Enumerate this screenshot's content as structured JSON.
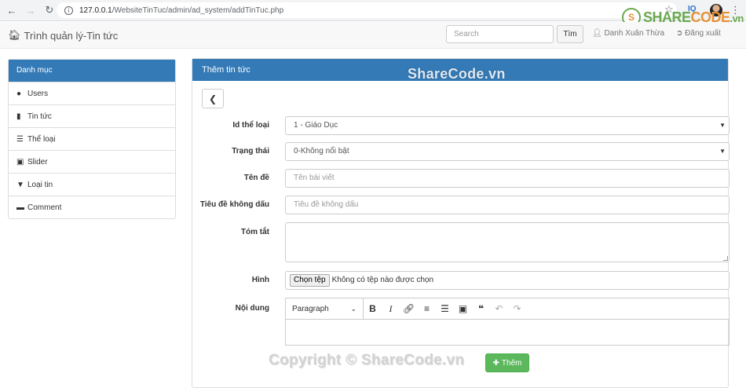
{
  "browser": {
    "url_host": "127.0.0.1",
    "url_path": "/WebsiteTinTuc/admin/ad_system/addTinTuc.php",
    "extension_label": "IQ"
  },
  "watermark": {
    "logo_share": "SHARE",
    "logo_code": "CODE",
    "logo_tld": ".vn",
    "logo_mark": "S",
    "top": "ShareCode.vn",
    "bottom": "Copyright © ShareCode.vn"
  },
  "navbar": {
    "brand": "Trình quản lý-Tin tức",
    "search_placeholder": "Search",
    "search_button": "Tìm",
    "user_name": "Danh Xuân Thừa",
    "logout": "Đăng xuất"
  },
  "sidebar": {
    "title": "Danh mục",
    "items": [
      {
        "label": "Users",
        "icon": "user-icon"
      },
      {
        "label": "Tin tức",
        "icon": "file-icon"
      },
      {
        "label": "Thể loại",
        "icon": "list-icon"
      },
      {
        "label": "Slider",
        "icon": "slider-icon"
      },
      {
        "label": "Loại tin",
        "icon": "filter-icon"
      },
      {
        "label": "Comment",
        "icon": "comment-icon"
      }
    ]
  },
  "form": {
    "title": "Thêm tin tức",
    "fields": {
      "category": {
        "label": "Id thể loại",
        "value": "1 - Giáo Dục"
      },
      "status": {
        "label": "Trạng thái",
        "value": "0-Không nổi bật"
      },
      "title": {
        "label": "Tên đề",
        "placeholder": "Tên bài viết"
      },
      "slug": {
        "label": "Tiêu đề không dấu",
        "placeholder": "Tiêu đề không dấu"
      },
      "summary": {
        "label": "Tóm tắt",
        "value": ""
      },
      "image": {
        "label": "Hình",
        "button": "Chọn tệp",
        "status": "Không có tệp nào được chọn"
      },
      "content": {
        "label": "Nội dung",
        "format": "Paragraph"
      }
    },
    "submit": "Thêm"
  },
  "colors": {
    "primary": "#337ab7",
    "success": "#5cb85c",
    "logo_green": "#6aa84f",
    "logo_orange": "#e69138"
  }
}
